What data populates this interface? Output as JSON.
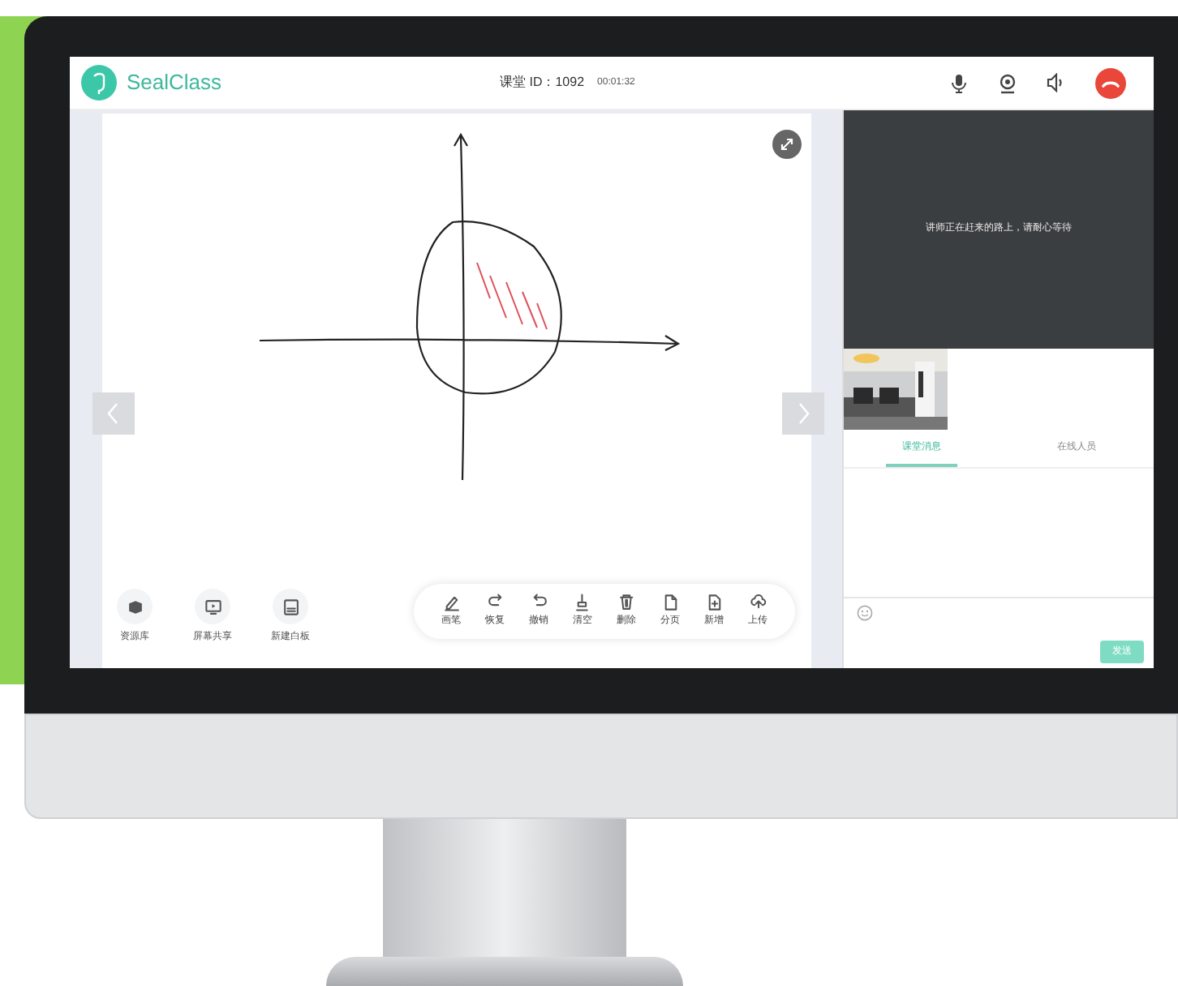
{
  "header": {
    "brand": "SealClass",
    "class_id": "课堂 ID：1092",
    "timer": "00:01:32"
  },
  "video": {
    "message": "讲师正在赶来的路上，请耐心等待"
  },
  "whiteboard": {
    "left_tools": [
      {
        "kind": "resources",
        "label": "资源库"
      },
      {
        "kind": "screen",
        "label": "屏幕共享"
      },
      {
        "kind": "board",
        "label": "新建白板"
      }
    ],
    "toolbar": [
      {
        "kind": "pen",
        "label": "画笔"
      },
      {
        "kind": "redo",
        "label": "恢复"
      },
      {
        "kind": "undo",
        "label": "撤销"
      },
      {
        "kind": "clear",
        "label": "清空"
      },
      {
        "kind": "delete",
        "label": "删除"
      },
      {
        "kind": "page",
        "label": "分页"
      },
      {
        "kind": "add",
        "label": "新增"
      },
      {
        "kind": "upload",
        "label": "上传"
      }
    ]
  },
  "tabs": [
    {
      "label": "课堂消息",
      "selected": true
    },
    {
      "label": "在线人员",
      "selected": false
    }
  ],
  "send_button": "发送"
}
